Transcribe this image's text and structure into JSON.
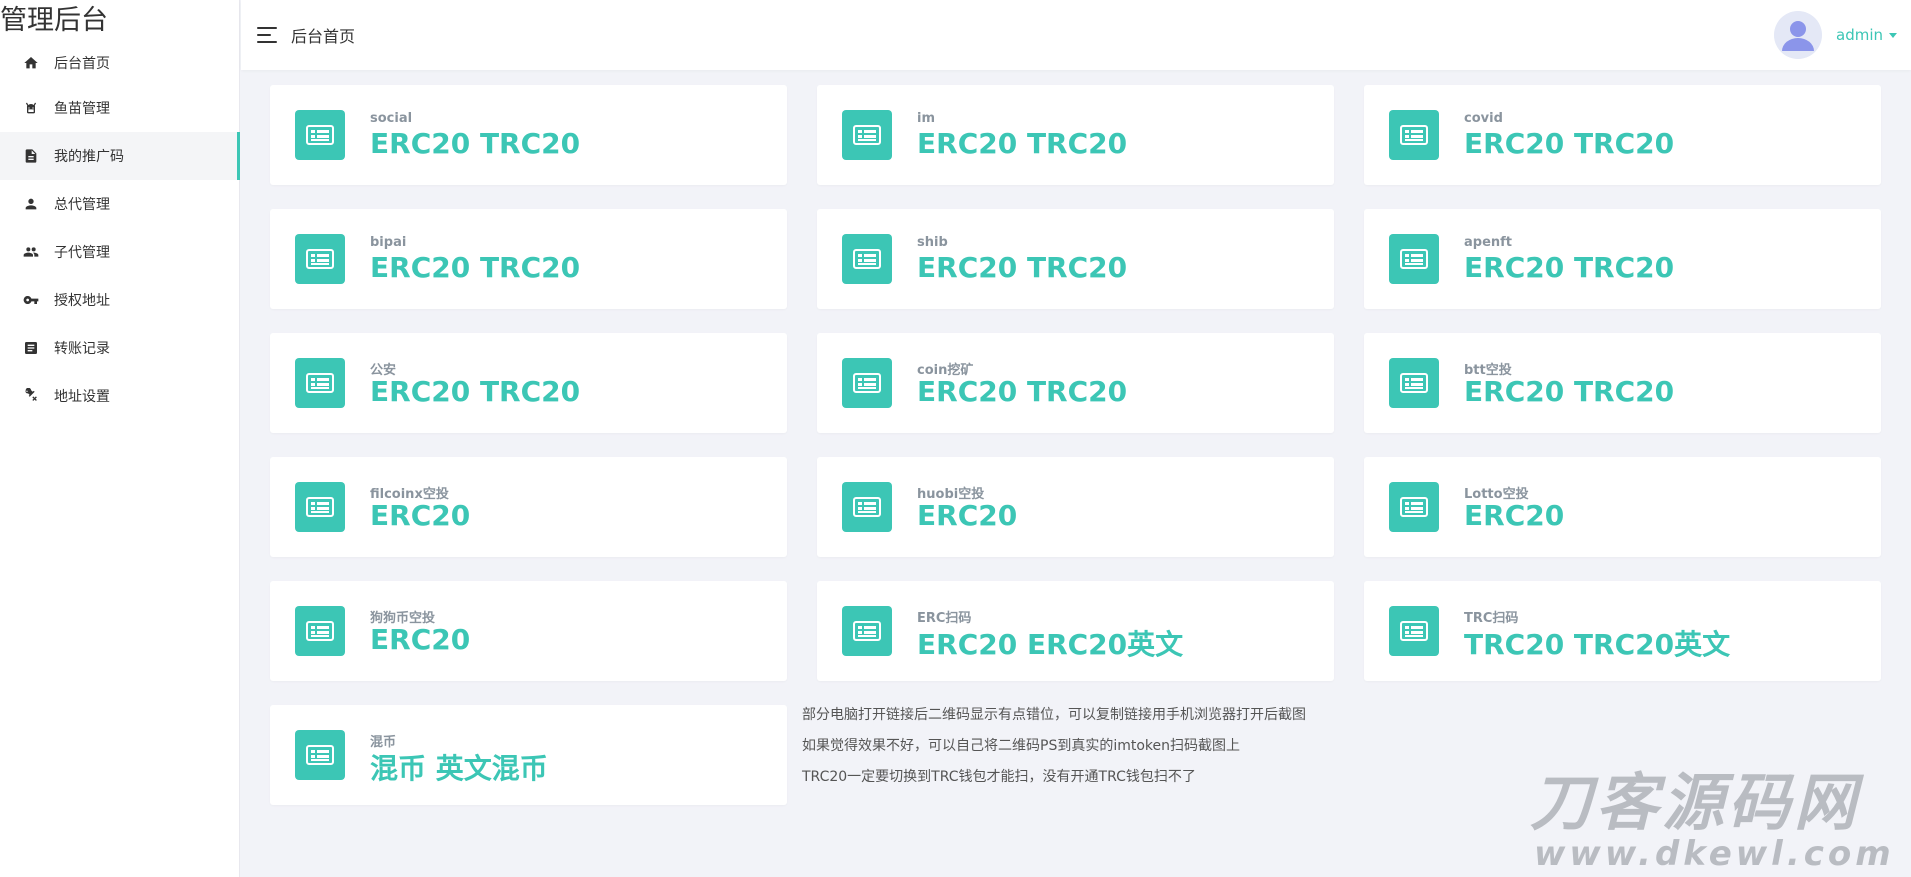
{
  "brand": "管理后台",
  "sidebar": {
    "items": [
      {
        "label": "后台首页",
        "icon": "home-icon"
      },
      {
        "label": "鱼苗管理",
        "icon": "fish-icon"
      },
      {
        "label": "我的推广码",
        "icon": "document-icon",
        "active": true
      },
      {
        "label": "总代管理",
        "icon": "person-icon"
      },
      {
        "label": "子代管理",
        "icon": "people-icon"
      },
      {
        "label": "授权地址",
        "icon": "key-icon"
      },
      {
        "label": "转账记录",
        "icon": "list-icon"
      },
      {
        "label": "地址设置",
        "icon": "tools-icon"
      }
    ]
  },
  "header": {
    "title": "后台首页",
    "menu_icon": "menu-icon",
    "user": {
      "name": "admin",
      "avatar_icon": "avatar-icon"
    }
  },
  "cards": [
    {
      "label": "social",
      "value": "ERC20 TRC20"
    },
    {
      "label": "im",
      "value": "ERC20 TRC20"
    },
    {
      "label": "covid",
      "value": "ERC20 TRC20"
    },
    {
      "label": "bipai",
      "value": "ERC20 TRC20"
    },
    {
      "label": "shib",
      "value": "ERC20 TRC20"
    },
    {
      "label": "apenft",
      "value": "ERC20 TRC20"
    },
    {
      "label": "公安",
      "value": "ERC20 TRC20"
    },
    {
      "label": "coin挖矿",
      "value": "ERC20 TRC20"
    },
    {
      "label": "btt空投",
      "value": "ERC20 TRC20"
    },
    {
      "label": "filcoinx空投",
      "value": "ERC20"
    },
    {
      "label": "huobi空投",
      "value": "ERC20"
    },
    {
      "label": "Lotto空投",
      "value": "ERC20"
    },
    {
      "label": "狗狗币空投",
      "value": "ERC20"
    },
    {
      "label": "ERC扫码",
      "value": "ERC20 ERC20英文"
    },
    {
      "label": "TRC扫码",
      "value": "TRC20 TRC20英文"
    },
    {
      "label": "混币",
      "value": "混币 英文混币"
    }
  ],
  "notes": [
    "部分电脑打开链接后二维码显示有点错位，可以复制链接用手机浏览器打开后截图",
    "如果觉得效果不好，可以自己将二维码PS到真实的imtoken扫码截图上",
    "TRC20一定要切换到TRC钱包才能扫，没有开通TRC钱包扫不了"
  ],
  "watermark": {
    "top": "刀客源码网",
    "bottom": "www.dkewl.com"
  },
  "colors": {
    "accent": "#3cc6b5",
    "background": "#f2f3f8",
    "card": "#ffffff",
    "label": "#8a949e"
  }
}
